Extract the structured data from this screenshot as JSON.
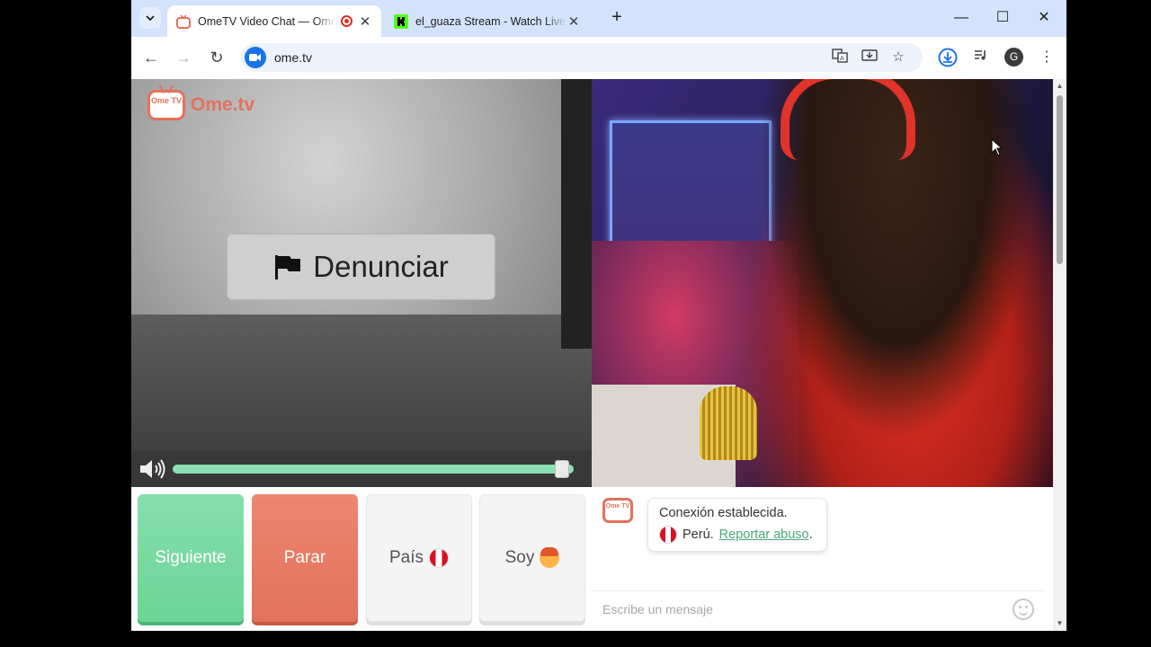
{
  "browser": {
    "tabs": [
      {
        "title": "OmeTV Video Chat — Ome",
        "active": true,
        "recording": true
      },
      {
        "title": "el_guaza Stream - Watch Live o",
        "active": false
      }
    ],
    "new_tab": "+",
    "window_controls": [
      "minimize-icon",
      "maximize-icon",
      "close-icon"
    ],
    "url": "ome.tv",
    "profile_initial": "G"
  },
  "page": {
    "logo_text": "Ome.tv",
    "logo_tv_text": "Ome TV",
    "report_button": "Denunciar",
    "volume_level": 0.97,
    "buttons": {
      "next": "Siguiente",
      "stop": "Parar",
      "country": "País",
      "gender": "Soy"
    },
    "chat": {
      "system_message": "Conexión establecida.",
      "country": "Perú.",
      "report_link": "Reportar abuso",
      "report_suffix": ".",
      "input_placeholder": "Escribe un mensaje"
    }
  },
  "colors": {
    "brand": "#e2725b",
    "next_green": "#6cd497",
    "stop_red": "#e2725b",
    "chrome_tabstrip": "#d3e3fd"
  }
}
